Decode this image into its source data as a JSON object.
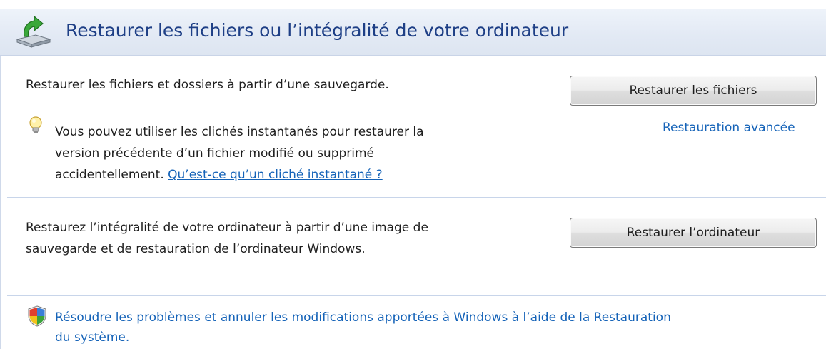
{
  "header": {
    "title": "Restaurer les fichiers ou l’intégralité de votre ordinateur",
    "icon": "restore-computer-icon"
  },
  "files_section": {
    "description": "Restaurer les fichiers et dossiers à partir d’une sauvegarde.",
    "button_label": "Restaurer les fichiers",
    "advanced_link": "Restauration avancée",
    "tip_line1": "Vous pouvez utiliser les clichés instantanés pour restaurer la",
    "tip_line2": "version précédente d’un fichier modifié ou supprimé",
    "tip_line3_prefix": "accidentellement. ",
    "tip_link": "Qu’est-ce qu’un cliché instantané ?",
    "tip_icon": "lightbulb-icon"
  },
  "computer_section": {
    "description_line1": "Restaurez l’intégralité de votre ordinateur à partir d’une image de",
    "description_line2": "sauvegarde et de restauration de l’ordinateur Windows.",
    "button_label": "Restaurer l’ordinateur"
  },
  "system_restore": {
    "link_line1": "Résoudre les problèmes et annuler les modifications apportées à Windows à l’aide de la Restauration",
    "link_line2": "du système.",
    "icon": "uac-shield-icon"
  },
  "colors": {
    "title": "#1e3f86",
    "link": "#1563b8",
    "header_bg": "#e2e9f4",
    "divider": "#c8d5ea"
  }
}
